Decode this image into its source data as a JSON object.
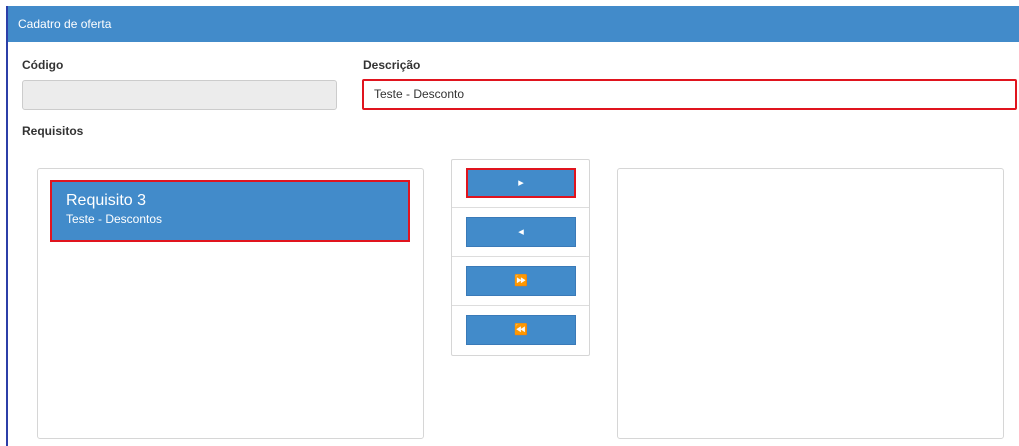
{
  "window": {
    "title": "Cadatro de oferta"
  },
  "form": {
    "codigo_label": "Código",
    "codigo_value": "",
    "descricao_label": "Descrição",
    "descricao_value": "Teste - Desconto",
    "requisitos_label": "Requisitos"
  },
  "available_list": {
    "items": [
      {
        "title": "Requisito 3",
        "subtitle": "Teste - Descontos",
        "selected": true
      }
    ]
  },
  "selected_list": {
    "items": []
  },
  "transfer_buttons": [
    {
      "name": "move-right-button",
      "icon": "chevron-right-icon",
      "glyph": "▸"
    },
    {
      "name": "move-left-button",
      "icon": "chevron-left-icon",
      "glyph": "◂"
    },
    {
      "name": "move-all-right-button",
      "icon": "double-chevron-right-icon",
      "glyph": "⏩"
    },
    {
      "name": "move-all-left-button",
      "icon": "double-chevron-left-icon",
      "glyph": "⏪"
    }
  ],
  "colors": {
    "primary": "#428bca",
    "highlight": "#e0141e",
    "disabled_input": "#ececec"
  }
}
